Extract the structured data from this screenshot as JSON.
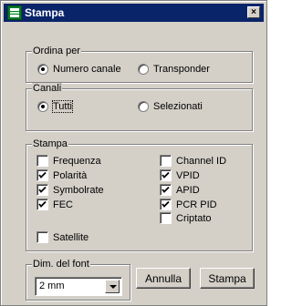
{
  "window": {
    "title": "Stampa",
    "close_glyph": "×"
  },
  "groups": {
    "ordina": {
      "legend": "Ordina per",
      "options": [
        {
          "label": "Numero canale",
          "selected": true
        },
        {
          "label": "Transponder",
          "selected": false
        }
      ]
    },
    "canali": {
      "legend": "Canali",
      "options": [
        {
          "label": "Tutti",
          "selected": true
        },
        {
          "label": "Selezionati",
          "selected": false
        }
      ]
    },
    "stampa": {
      "legend": "Stampa",
      "left": [
        {
          "label": "Frequenza",
          "checked": false
        },
        {
          "label": "Polarità",
          "checked": true
        },
        {
          "label": "Symbolrate",
          "checked": true
        },
        {
          "label": "FEC",
          "checked": true
        },
        {
          "label": "Satellite",
          "checked": false
        }
      ],
      "right": [
        {
          "label": "Channel ID",
          "checked": false
        },
        {
          "label": "VPID",
          "checked": true
        },
        {
          "label": "APID",
          "checked": true
        },
        {
          "label": "PCR PID",
          "checked": true
        },
        {
          "label": "Criptato",
          "checked": false
        }
      ]
    },
    "font": {
      "legend": "Dim. del font",
      "value": "2 mm"
    }
  },
  "buttons": {
    "cancel": "Annulla",
    "print": "Stampa"
  },
  "colors": {
    "titlebar": "#0a246a",
    "face": "#d4d0c8",
    "icon_green": "#0a7a2c"
  },
  "icons": {
    "app": "print-app-icon",
    "close": "close-icon",
    "combo": "chevron-down-icon",
    "check": "checkmark-icon"
  }
}
